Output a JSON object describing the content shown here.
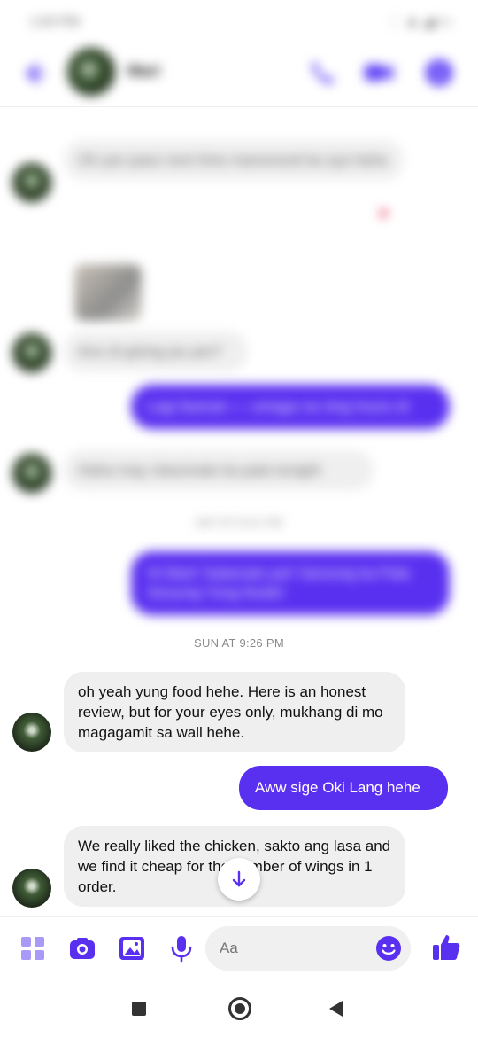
{
  "status_bar": {
    "time": "1:04 PM",
    "icons": "⋮ ▲ ◢ ▭"
  },
  "header": {
    "contact_name": "Mari"
  },
  "messages": [
    {
      "from": "them",
      "text": "Oh yes pass next time manonood ka sya haha",
      "blurred": true
    },
    {
      "from": "them",
      "text": "Ano di gising pa yan?",
      "blurred": true
    },
    {
      "from": "me",
      "text": "Lagi ikaman — umaga na ning hours di",
      "blurred": true
    },
    {
      "from": "them",
      "text": "Haha may classmate ka pala tonight",
      "blurred": true
    },
    {
      "from": "me",
      "text": "Hi Mari! Salamats pa!! Sarsong ka Pala Sa'yung Yung foods!",
      "blurred": true
    },
    {
      "from": "them",
      "text": "oh yeah yung food hehe. Here is an honest review, but for your eyes only, mukhang di mo magagamit sa wall hehe.",
      "blurred": false
    },
    {
      "from": "me",
      "text": "Aww sige Oki Lang hehe",
      "blurred": false
    },
    {
      "from": "them",
      "text": "We really liked the chicken, sakto ang lasa and we find it cheap for the number of wings in 1 order.",
      "blurred": false
    }
  ],
  "timestamps": {
    "blurred_one": "SAT AT 8:01 PM",
    "sunday": "SUN AT 9:26 PM"
  },
  "composer": {
    "placeholder": "Aa"
  },
  "colors": {
    "accent": "#5a30f0",
    "incoming_bubble": "#efefef"
  }
}
